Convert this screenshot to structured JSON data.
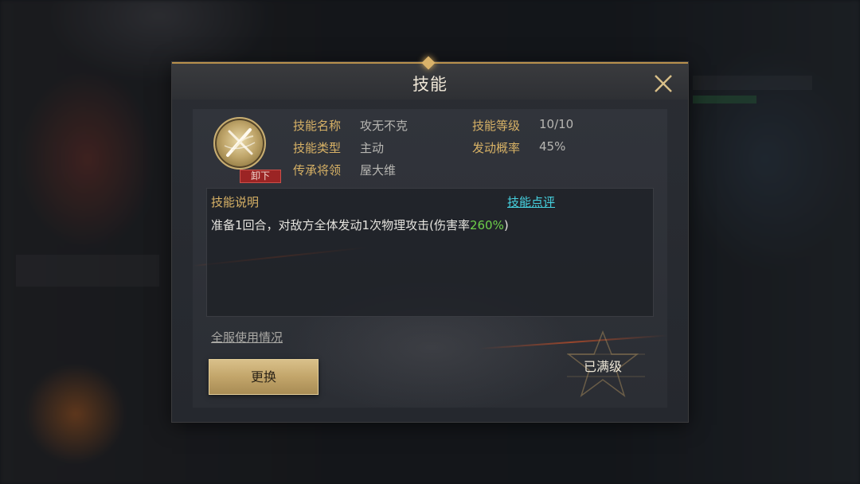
{
  "dialog": {
    "title": "技能",
    "close_icon": "close-icon"
  },
  "skill": {
    "icon": "crossed-blades-icon",
    "unequip_label": "卸下",
    "fields": [
      {
        "label": "技能名称",
        "value": "攻无不克"
      },
      {
        "label": "技能类型",
        "value": "主动"
      },
      {
        "label": "传承将领",
        "value": "屋大维"
      },
      {
        "label": "技能等级",
        "value": "10/10"
      },
      {
        "label": "发动概率",
        "value": "45%"
      }
    ]
  },
  "description": {
    "title": "技能说明",
    "review_link": "技能点评",
    "text_before": "准备1回合，对敌方全体发动1次物理攻击(伤害率",
    "highlight": "260%",
    "text_after": ")"
  },
  "footer": {
    "usage_link": "全服使用情况",
    "replace_button": "更换",
    "maxed_label": "已满级"
  },
  "colors": {
    "gold_label": "#d8b266",
    "link_cyan": "#46d2e0",
    "highlight_green": "#6ed04a",
    "badge_red": "#9b2424"
  }
}
